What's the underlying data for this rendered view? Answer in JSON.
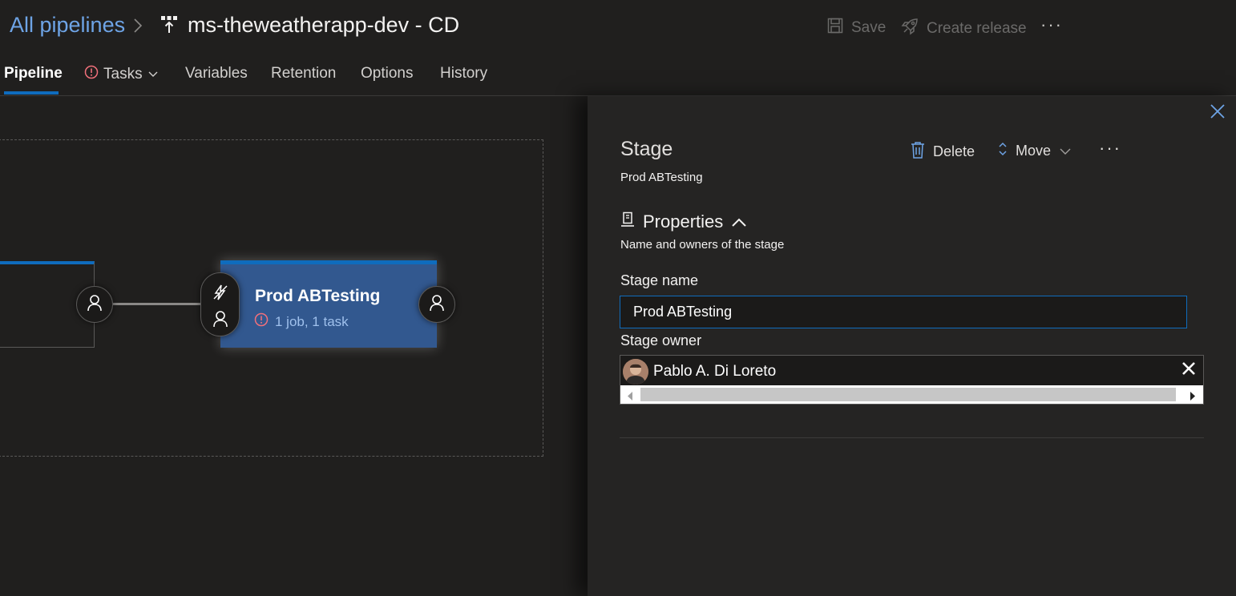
{
  "header": {
    "breadcrumb_link": "All pipelines",
    "pipeline_title": "ms-theweatherapp-dev - CD",
    "save_label": "Save",
    "create_release_label": "Create release",
    "more_label": "···"
  },
  "tabs": [
    {
      "label": "Pipeline"
    },
    {
      "label": "Tasks"
    },
    {
      "label": "Variables"
    },
    {
      "label": "Retention"
    },
    {
      "label": "Options"
    },
    {
      "label": "History"
    }
  ],
  "canvas": {
    "stage_card": {
      "title": "Prod ABTesting",
      "summary": "1 job, 1 task"
    }
  },
  "panel": {
    "title": "Stage",
    "subtitle": "Prod ABTesting",
    "delete_label": "Delete",
    "move_label": "Move",
    "more_label": "···",
    "section_title": "Properties",
    "section_desc": "Name and owners of the stage",
    "stage_name_label": "Stage name",
    "stage_name_value": "Prod ABTesting",
    "stage_owner_label": "Stage owner",
    "owner_name": "Pablo A. Di Loreto"
  },
  "colors": {
    "accent": "#0f6cbd",
    "link": "#6ea4e6",
    "error": "#f1707b",
    "stage_card": "#32588f"
  }
}
